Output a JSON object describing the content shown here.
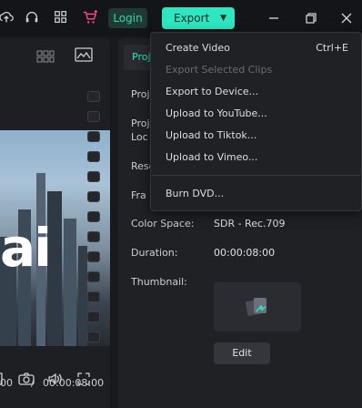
{
  "topbar": {
    "login_label": "Login",
    "export_label": "Export",
    "icons": [
      "cloud-upload-icon",
      "headset-icon",
      "apps-grid-icon",
      "cart-icon"
    ],
    "accent": "#2ee6c0"
  },
  "export_menu": {
    "items": [
      {
        "label": "Create Video",
        "shortcut": "Ctrl+E",
        "enabled": true
      },
      {
        "label": "Export Selected Clips",
        "shortcut": "",
        "enabled": false
      },
      {
        "label": "Export to Device...",
        "shortcut": "",
        "enabled": true
      },
      {
        "label": "Upload to YouTube...",
        "shortcut": "",
        "enabled": true
      },
      {
        "label": "Upload to Tiktok...",
        "shortcut": "",
        "enabled": true
      },
      {
        "label": "Upload to Vimeo...",
        "shortcut": "",
        "enabled": true
      },
      {
        "label": "Burn DVD...",
        "shortcut": "",
        "enabled": true
      }
    ]
  },
  "preview": {
    "overlay_text": "ai",
    "current_time": "00",
    "separator": "/",
    "total_time": "00:00:08:00"
  },
  "properties": {
    "tab_label": "Proj",
    "rows": [
      {
        "label": "Proj",
        "value": ""
      },
      {
        "label": "Proj",
        "value": ""
      },
      {
        "label": "Loc",
        "value": ""
      },
      {
        "label": "Reso",
        "value": ""
      },
      {
        "label": "Fra",
        "value": ""
      },
      {
        "label": "Color Space:",
        "value": "SDR - Rec.709"
      },
      {
        "label": "Duration:",
        "value": "00:00:08:00"
      },
      {
        "label": "Thumbnail:",
        "value": ""
      }
    ],
    "edit_label": "Edit"
  }
}
